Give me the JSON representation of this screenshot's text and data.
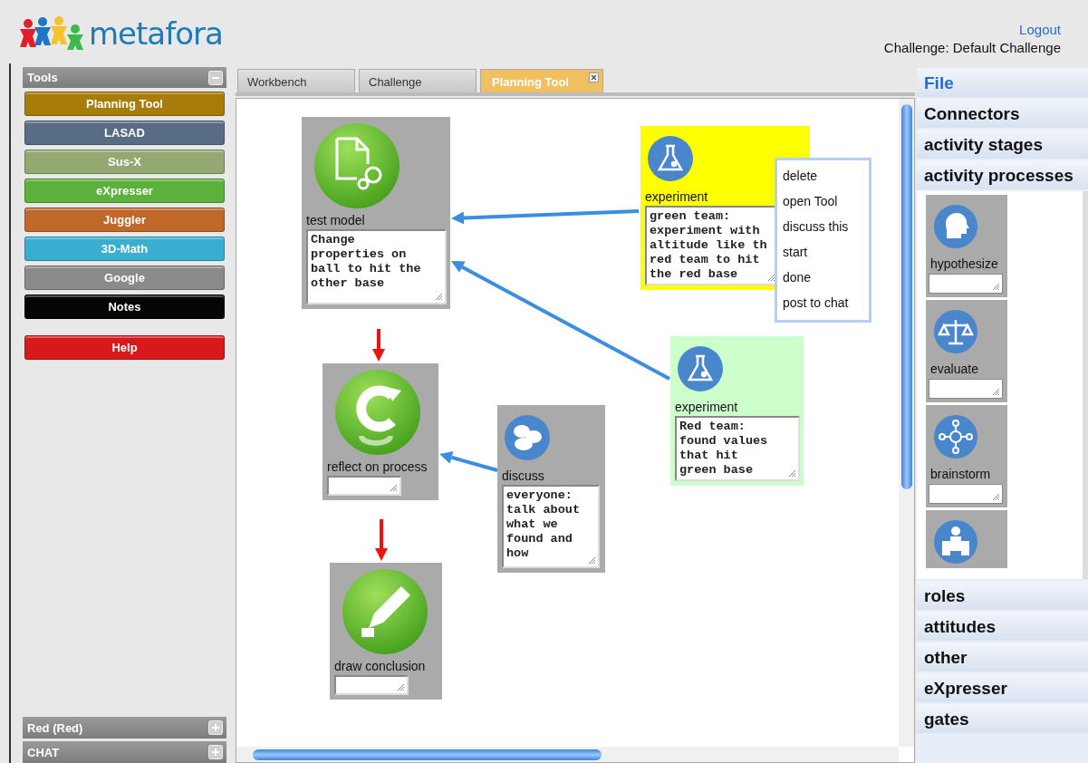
{
  "header": {
    "logo": "metafora",
    "logout": "Logout",
    "challenge": "Challenge: Default Challenge"
  },
  "sidebar": {
    "tools_panel": {
      "title": "Tools",
      "expanded": true
    },
    "tools": [
      {
        "label": "Planning Tool",
        "color": "#a87c08"
      },
      {
        "label": "LASAD",
        "color": "#566d85"
      },
      {
        "label": "Sus-X",
        "color": "#94a872"
      },
      {
        "label": "eXpresser",
        "color": "#5cb03c"
      },
      {
        "label": "Juggler",
        "color": "#c0672a"
      },
      {
        "label": "3D-Math",
        "color": "#3aaed0"
      },
      {
        "label": "Google",
        "color": "#8a8a8a"
      },
      {
        "label": "Notes",
        "color": "#050505"
      }
    ],
    "help": "Help",
    "bottom_panels": [
      {
        "title": "Red (Red)",
        "expanded": false
      },
      {
        "title": "CHAT",
        "expanded": false
      }
    ]
  },
  "tabs": [
    {
      "label": "Workbench",
      "selected": false
    },
    {
      "label": "Challenge",
      "selected": false
    },
    {
      "label": "Planning Tool",
      "selected": true
    }
  ],
  "canvas": {
    "nodes": [
      {
        "kind": "stage",
        "label": "test model",
        "value": "Change\nproperties on\nball to hit the\nother base",
        "color": "#aaaaaa"
      },
      {
        "kind": "process",
        "label": "experiment",
        "value": "green team:\nexperiment with\naltitude like th\nred team to hit\nthe red base",
        "color": "#ffff00"
      },
      {
        "kind": "stage",
        "label": "reflect on process",
        "color": "#aaaaaa"
      },
      {
        "kind": "process",
        "label": "discuss",
        "value": "everyone:\ntalk about\nwhat we\nfound and\nhow",
        "color": "#aaaaaa"
      },
      {
        "kind": "process",
        "label": "experiment",
        "value": "Red team:\nfound values\nthat hit\ngreen base",
        "color": "#ccffcc"
      },
      {
        "kind": "stage",
        "label": "draw conclusion",
        "color": "#aaaaaa"
      }
    ],
    "context_menu": [
      "delete",
      "open Tool",
      "discuss this",
      "start",
      "done",
      "post to chat"
    ]
  },
  "palette": {
    "sections": [
      {
        "title": "File",
        "selected": true
      },
      {
        "title": "Connectors",
        "selected": false
      },
      {
        "title": "activity stages",
        "selected": false
      },
      {
        "title": "activity processes",
        "selected": false,
        "items": [
          {
            "kind": "full",
            "label": "hypothesize"
          },
          {
            "kind": "full",
            "label": "evaluate"
          },
          {
            "kind": "full",
            "label": "brainstorm"
          },
          {
            "kind": "partial"
          }
        ]
      },
      {
        "title": "roles",
        "selected": false
      },
      {
        "title": "attitudes",
        "selected": false
      },
      {
        "title": "other",
        "selected": false
      },
      {
        "title": "eXpresser",
        "selected": false
      },
      {
        "title": "gates",
        "selected": false
      }
    ]
  }
}
